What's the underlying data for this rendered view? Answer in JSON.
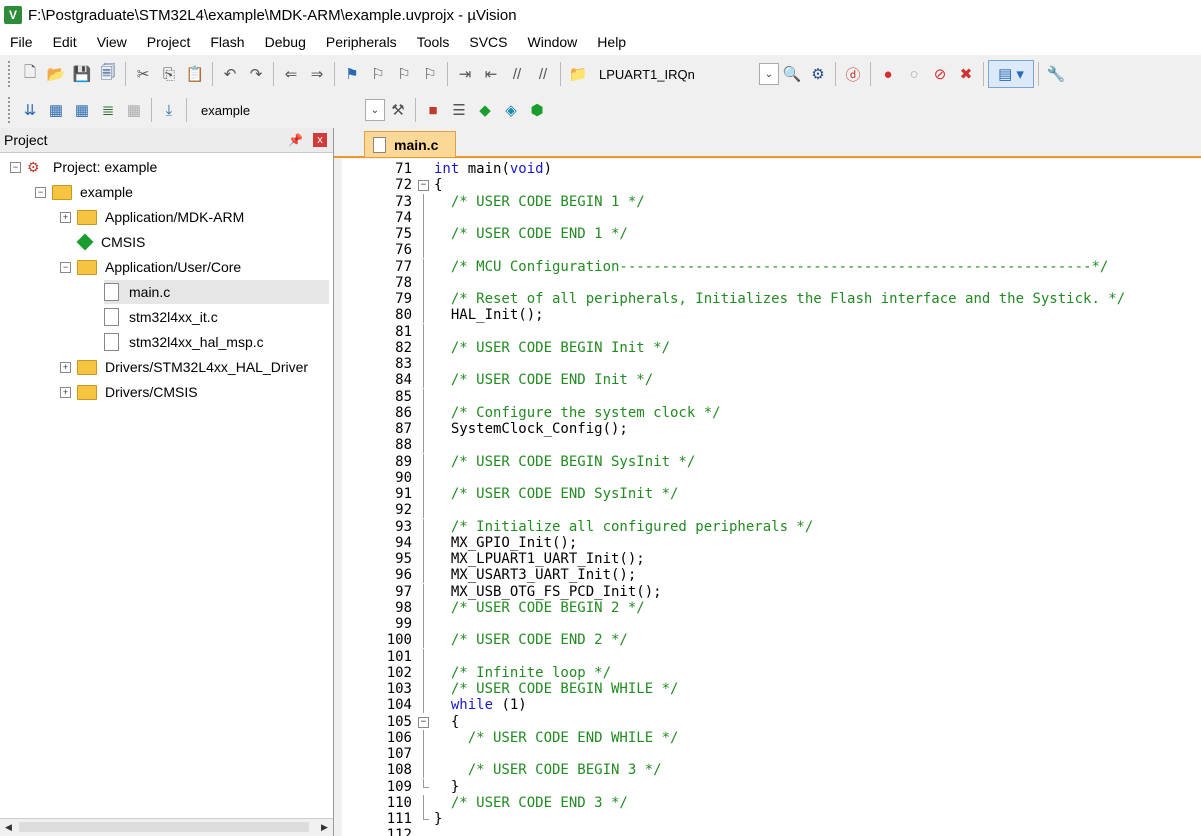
{
  "window": {
    "title": "F:\\Postgraduate\\STM32L4\\example\\MDK-ARM\\example.uvprojx - µVision",
    "icon_letter": "V"
  },
  "menu": [
    "File",
    "Edit",
    "View",
    "Project",
    "Flash",
    "Debug",
    "Peripherals",
    "Tools",
    "SVCS",
    "Window",
    "Help"
  ],
  "toolbar": {
    "function_combo": "LPUART1_IRQn",
    "target_combo": "example"
  },
  "project_panel": {
    "title": "Project",
    "pin": "ᵖ",
    "close": "x",
    "tree": [
      {
        "label": "Project: example",
        "level": 0,
        "kind": "project",
        "expander": "−"
      },
      {
        "label": "example",
        "level": 1,
        "kind": "target",
        "expander": "−"
      },
      {
        "label": "Application/MDK-ARM",
        "level": 2,
        "kind": "folder",
        "expander": "+"
      },
      {
        "label": "CMSIS",
        "level": 2,
        "kind": "component",
        "expander": ""
      },
      {
        "label": "Application/User/Core",
        "level": 2,
        "kind": "folder",
        "expander": "−"
      },
      {
        "label": "main.c",
        "level": 3,
        "kind": "file",
        "expander": "",
        "selected": true
      },
      {
        "label": "stm32l4xx_it.c",
        "level": 3,
        "kind": "file",
        "expander": ""
      },
      {
        "label": "stm32l4xx_hal_msp.c",
        "level": 3,
        "kind": "file",
        "expander": ""
      },
      {
        "label": "Drivers/STM32L4xx_HAL_Driver",
        "level": 2,
        "kind": "folder",
        "expander": "+"
      },
      {
        "label": "Drivers/CMSIS",
        "level": 2,
        "kind": "folder",
        "expander": "+"
      }
    ]
  },
  "editor": {
    "tab": "main.c",
    "lines": [
      {
        "n": "71",
        "fold": "",
        "segs": [
          [
            "kw",
            "int"
          ],
          [
            "",
            " main("
          ],
          [
            "kw",
            "void"
          ],
          [
            "",
            ")"
          ]
        ]
      },
      {
        "n": "72",
        "fold": "box",
        "segs": [
          [
            "",
            "{"
          ]
        ]
      },
      {
        "n": "73",
        "fold": "bar",
        "segs": [
          [
            "",
            "  "
          ],
          [
            "cm",
            "/* USER CODE BEGIN 1 */"
          ]
        ]
      },
      {
        "n": "74",
        "fold": "bar",
        "segs": []
      },
      {
        "n": "75",
        "fold": "bar",
        "segs": [
          [
            "",
            "  "
          ],
          [
            "cm",
            "/* USER CODE END 1 */"
          ]
        ]
      },
      {
        "n": "76",
        "fold": "bar",
        "segs": []
      },
      {
        "n": "77",
        "fold": "bar",
        "segs": [
          [
            "",
            "  "
          ],
          [
            "cm",
            "/* MCU Configuration--------------------------------------------------------*/"
          ]
        ]
      },
      {
        "n": "78",
        "fold": "bar",
        "segs": []
      },
      {
        "n": "79",
        "fold": "bar",
        "segs": [
          [
            "",
            "  "
          ],
          [
            "cm",
            "/* Reset of all peripherals, Initializes the Flash interface and the Systick. */"
          ]
        ]
      },
      {
        "n": "80",
        "fold": "bar",
        "segs": [
          [
            "",
            "  HAL_Init();"
          ]
        ]
      },
      {
        "n": "81",
        "fold": "bar",
        "segs": []
      },
      {
        "n": "82",
        "fold": "bar",
        "segs": [
          [
            "",
            "  "
          ],
          [
            "cm",
            "/* USER CODE BEGIN Init */"
          ]
        ]
      },
      {
        "n": "83",
        "fold": "bar",
        "segs": []
      },
      {
        "n": "84",
        "fold": "bar",
        "segs": [
          [
            "",
            "  "
          ],
          [
            "cm",
            "/* USER CODE END Init */"
          ]
        ]
      },
      {
        "n": "85",
        "fold": "bar",
        "segs": []
      },
      {
        "n": "86",
        "fold": "bar",
        "segs": [
          [
            "",
            "  "
          ],
          [
            "cm",
            "/* Configure the system clock */"
          ]
        ]
      },
      {
        "n": "87",
        "fold": "bar",
        "segs": [
          [
            "",
            "  SystemClock_Config();"
          ]
        ]
      },
      {
        "n": "88",
        "fold": "bar",
        "segs": []
      },
      {
        "n": "89",
        "fold": "bar",
        "segs": [
          [
            "",
            "  "
          ],
          [
            "cm",
            "/* USER CODE BEGIN SysInit */"
          ]
        ]
      },
      {
        "n": "90",
        "fold": "bar",
        "segs": []
      },
      {
        "n": "91",
        "fold": "bar",
        "segs": [
          [
            "",
            "  "
          ],
          [
            "cm",
            "/* USER CODE END SysInit */"
          ]
        ]
      },
      {
        "n": "92",
        "fold": "bar",
        "segs": []
      },
      {
        "n": "93",
        "fold": "bar",
        "segs": [
          [
            "",
            "  "
          ],
          [
            "cm",
            "/* Initialize all configured peripherals */"
          ]
        ]
      },
      {
        "n": "94",
        "fold": "bar",
        "segs": [
          [
            "",
            "  MX_GPIO_Init();"
          ]
        ]
      },
      {
        "n": "95",
        "fold": "bar",
        "segs": [
          [
            "",
            "  MX_LPUART1_UART_Init();"
          ]
        ]
      },
      {
        "n": "96",
        "fold": "bar",
        "segs": [
          [
            "",
            "  MX_USART3_UART_Init();"
          ]
        ]
      },
      {
        "n": "97",
        "fold": "bar",
        "segs": [
          [
            "",
            "  MX_USB_OTG_FS_PCD_Init();"
          ]
        ]
      },
      {
        "n": "98",
        "fold": "bar",
        "segs": [
          [
            "",
            "  "
          ],
          [
            "cm",
            "/* USER CODE BEGIN 2 */"
          ]
        ]
      },
      {
        "n": "99",
        "fold": "bar",
        "segs": []
      },
      {
        "n": "100",
        "fold": "bar",
        "segs": [
          [
            "",
            "  "
          ],
          [
            "cm",
            "/* USER CODE END 2 */"
          ]
        ]
      },
      {
        "n": "101",
        "fold": "bar",
        "segs": []
      },
      {
        "n": "102",
        "fold": "bar",
        "segs": [
          [
            "",
            "  "
          ],
          [
            "cm",
            "/* Infinite loop */"
          ]
        ]
      },
      {
        "n": "103",
        "fold": "bar",
        "segs": [
          [
            "",
            "  "
          ],
          [
            "cm",
            "/* USER CODE BEGIN WHILE */"
          ]
        ]
      },
      {
        "n": "104",
        "fold": "bar",
        "segs": [
          [
            "",
            "  "
          ],
          [
            "kw",
            "while"
          ],
          [
            "",
            " (1)"
          ]
        ]
      },
      {
        "n": "105",
        "fold": "box",
        "segs": [
          [
            "",
            "  {"
          ]
        ]
      },
      {
        "n": "106",
        "fold": "bar",
        "segs": [
          [
            "",
            "    "
          ],
          [
            "cm",
            "/* USER CODE END WHILE */"
          ]
        ]
      },
      {
        "n": "107",
        "fold": "bar",
        "segs": []
      },
      {
        "n": "108",
        "fold": "bar",
        "segs": [
          [
            "",
            "    "
          ],
          [
            "cm",
            "/* USER CODE BEGIN 3 */"
          ]
        ]
      },
      {
        "n": "109",
        "fold": "end",
        "segs": [
          [
            "",
            "  }"
          ]
        ]
      },
      {
        "n": "110",
        "fold": "bar",
        "segs": [
          [
            "",
            "  "
          ],
          [
            "cm",
            "/* USER CODE END 3 */"
          ]
        ]
      },
      {
        "n": "111",
        "fold": "end",
        "segs": [
          [
            "",
            "}"
          ]
        ]
      },
      {
        "n": "112",
        "fold": "",
        "segs": []
      }
    ]
  }
}
